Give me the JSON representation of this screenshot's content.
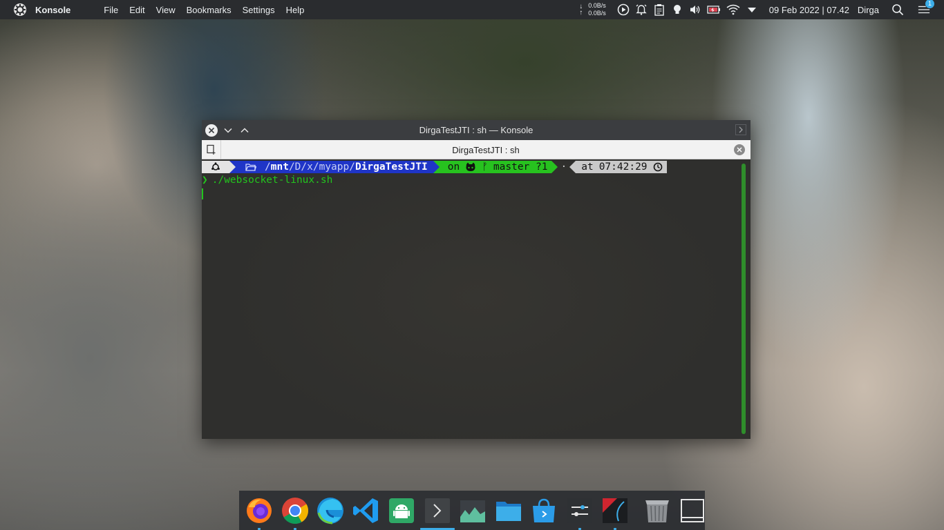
{
  "panel": {
    "app_name": "Konsole",
    "menu": [
      "File",
      "Edit",
      "View",
      "Bookmarks",
      "Settings",
      "Help"
    ],
    "net_down": "0.0B/s",
    "net_up": "0.0B/s",
    "clock": "09 Feb 2022 | 07.42",
    "username": "Dirga",
    "notification_count": "1",
    "tray_icons": [
      "timer-icon",
      "alarm-icon",
      "clipboard-icon",
      "lightbulb-icon",
      "volume-icon",
      "battery-icon",
      "wifi-icon",
      "expand-tray-icon"
    ]
  },
  "window": {
    "title": "DirgaTestJTI : sh — Konsole",
    "tab_title": "DirgaTestJTI : sh"
  },
  "terminal": {
    "prompt": {
      "path_prefix": "/",
      "path_mnt": "mnt",
      "path_mid": "/D/x/myapp/",
      "path_dir": "DirgaTestJTI",
      "git_on": "on",
      "git_branch_glyph": "ᚠ",
      "git_branch": "master ?1",
      "time_prefix": "at",
      "time": "07:42:29"
    },
    "prompt_char": "❯",
    "command": "./websocket-linux.sh"
  },
  "dock": {
    "items": [
      "firefox-icon",
      "chrome-icon",
      "edge-icon",
      "vscode-icon",
      "android-studio-icon",
      "konsole-icon",
      "system-monitor-icon",
      "file-manager-icon",
      "discover-icon",
      "settings-icon",
      "ide-icon",
      "archive-icon",
      "window-icon"
    ]
  },
  "colors": {
    "panel_bg": "#2a2c2f",
    "accent": "#3daee9",
    "prompt_dir_bg": "#1f35c7",
    "prompt_git_bg": "#27c21f",
    "prompt_time_bg": "#c9c9c9",
    "terminal_green": "#22c51d"
  }
}
